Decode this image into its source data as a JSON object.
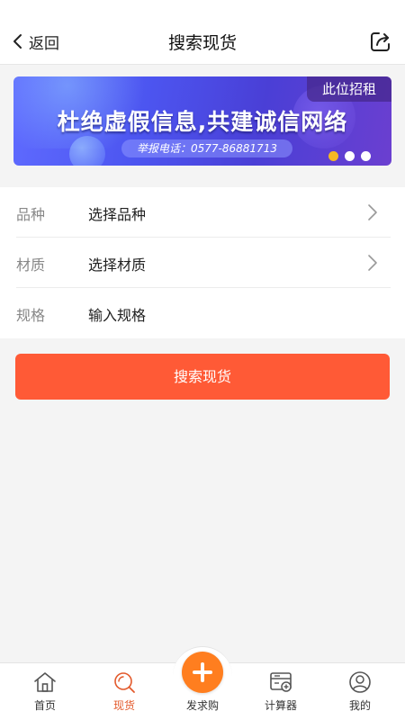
{
  "header": {
    "back_label": "返回",
    "title": "搜索现货"
  },
  "banner": {
    "tag": "此位招租",
    "headline": "杜绝虚假信息,共建诚信网络",
    "phone": "举报电话：0577-86881713",
    "dot_count": 3,
    "active_dot": 0,
    "colors": {
      "active_dot": "#f5b823"
    }
  },
  "form": {
    "rows": [
      {
        "label": "品种",
        "value": "选择品种"
      },
      {
        "label": "材质",
        "value": "选择材质"
      },
      {
        "label": "规格",
        "value": "输入规格"
      }
    ]
  },
  "search_button": {
    "label": "搜索现货",
    "color": "#ff5a36"
  },
  "bottom_nav": {
    "items": [
      {
        "label": "首页",
        "icon": "home-icon"
      },
      {
        "label": "现货",
        "icon": "search-icon",
        "active": true
      },
      {
        "label": "发求购",
        "icon": "plus-icon"
      },
      {
        "label": "计算器",
        "icon": "calculator-icon"
      },
      {
        "label": "我的",
        "icon": "user-icon"
      }
    ],
    "colors": {
      "active": "#e35a2c",
      "fab": "#ff7e1f"
    }
  }
}
